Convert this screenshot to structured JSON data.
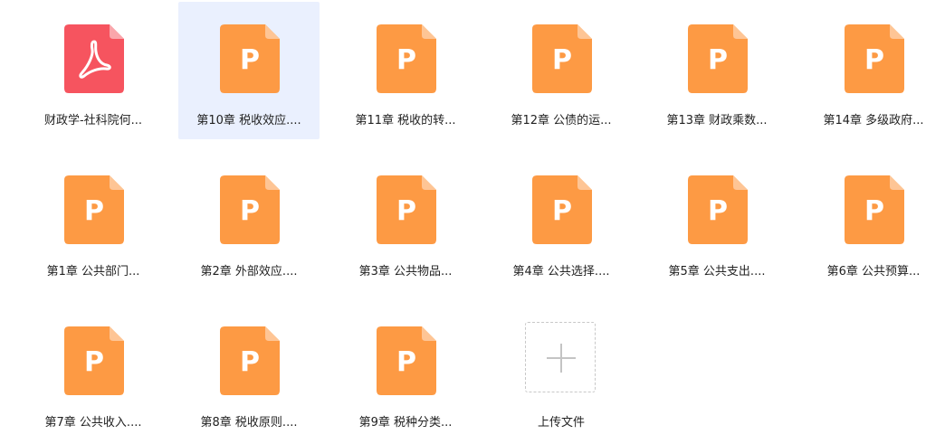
{
  "colors": {
    "ppt_orange": "#fd9a44",
    "ppt_fold": "#fec595",
    "pdf_red": "#f6545f",
    "pdf_fold": "#faa6ab",
    "selected_bg": "#eaf0fe"
  },
  "files": [
    {
      "name": "财政学-社科院何...",
      "type": "pdf",
      "icon": "pdf-icon",
      "selected": false
    },
    {
      "name": "第10章 税收效应....",
      "type": "ppt",
      "icon": "ppt-icon",
      "selected": true
    },
    {
      "name": "第11章 税收的转...",
      "type": "ppt",
      "icon": "ppt-icon",
      "selected": false
    },
    {
      "name": "第12章 公债的运...",
      "type": "ppt",
      "icon": "ppt-icon",
      "selected": false
    },
    {
      "name": "第13章 财政乘数...",
      "type": "ppt",
      "icon": "ppt-icon",
      "selected": false
    },
    {
      "name": "第14章 多级政府...",
      "type": "ppt",
      "icon": "ppt-icon",
      "selected": false
    },
    {
      "name": "第1章 公共部门...",
      "type": "ppt",
      "icon": "ppt-icon",
      "selected": false
    },
    {
      "name": "第2章 外部效应....",
      "type": "ppt",
      "icon": "ppt-icon",
      "selected": false
    },
    {
      "name": "第3章 公共物品...",
      "type": "ppt",
      "icon": "ppt-icon",
      "selected": false
    },
    {
      "name": "第4章 公共选择....",
      "type": "ppt",
      "icon": "ppt-icon",
      "selected": false
    },
    {
      "name": "第5章 公共支出....",
      "type": "ppt",
      "icon": "ppt-icon",
      "selected": false
    },
    {
      "name": "第6章 公共预算...",
      "type": "ppt",
      "icon": "ppt-icon",
      "selected": false
    },
    {
      "name": "第7章 公共收入....",
      "type": "ppt",
      "icon": "ppt-icon",
      "selected": false
    },
    {
      "name": "第8章 税收原则....",
      "type": "ppt",
      "icon": "ppt-icon",
      "selected": false
    },
    {
      "name": "第9章 税种分类...",
      "type": "ppt",
      "icon": "ppt-icon",
      "selected": false
    }
  ],
  "upload": {
    "label": "上传文件",
    "icon": "plus-icon"
  }
}
